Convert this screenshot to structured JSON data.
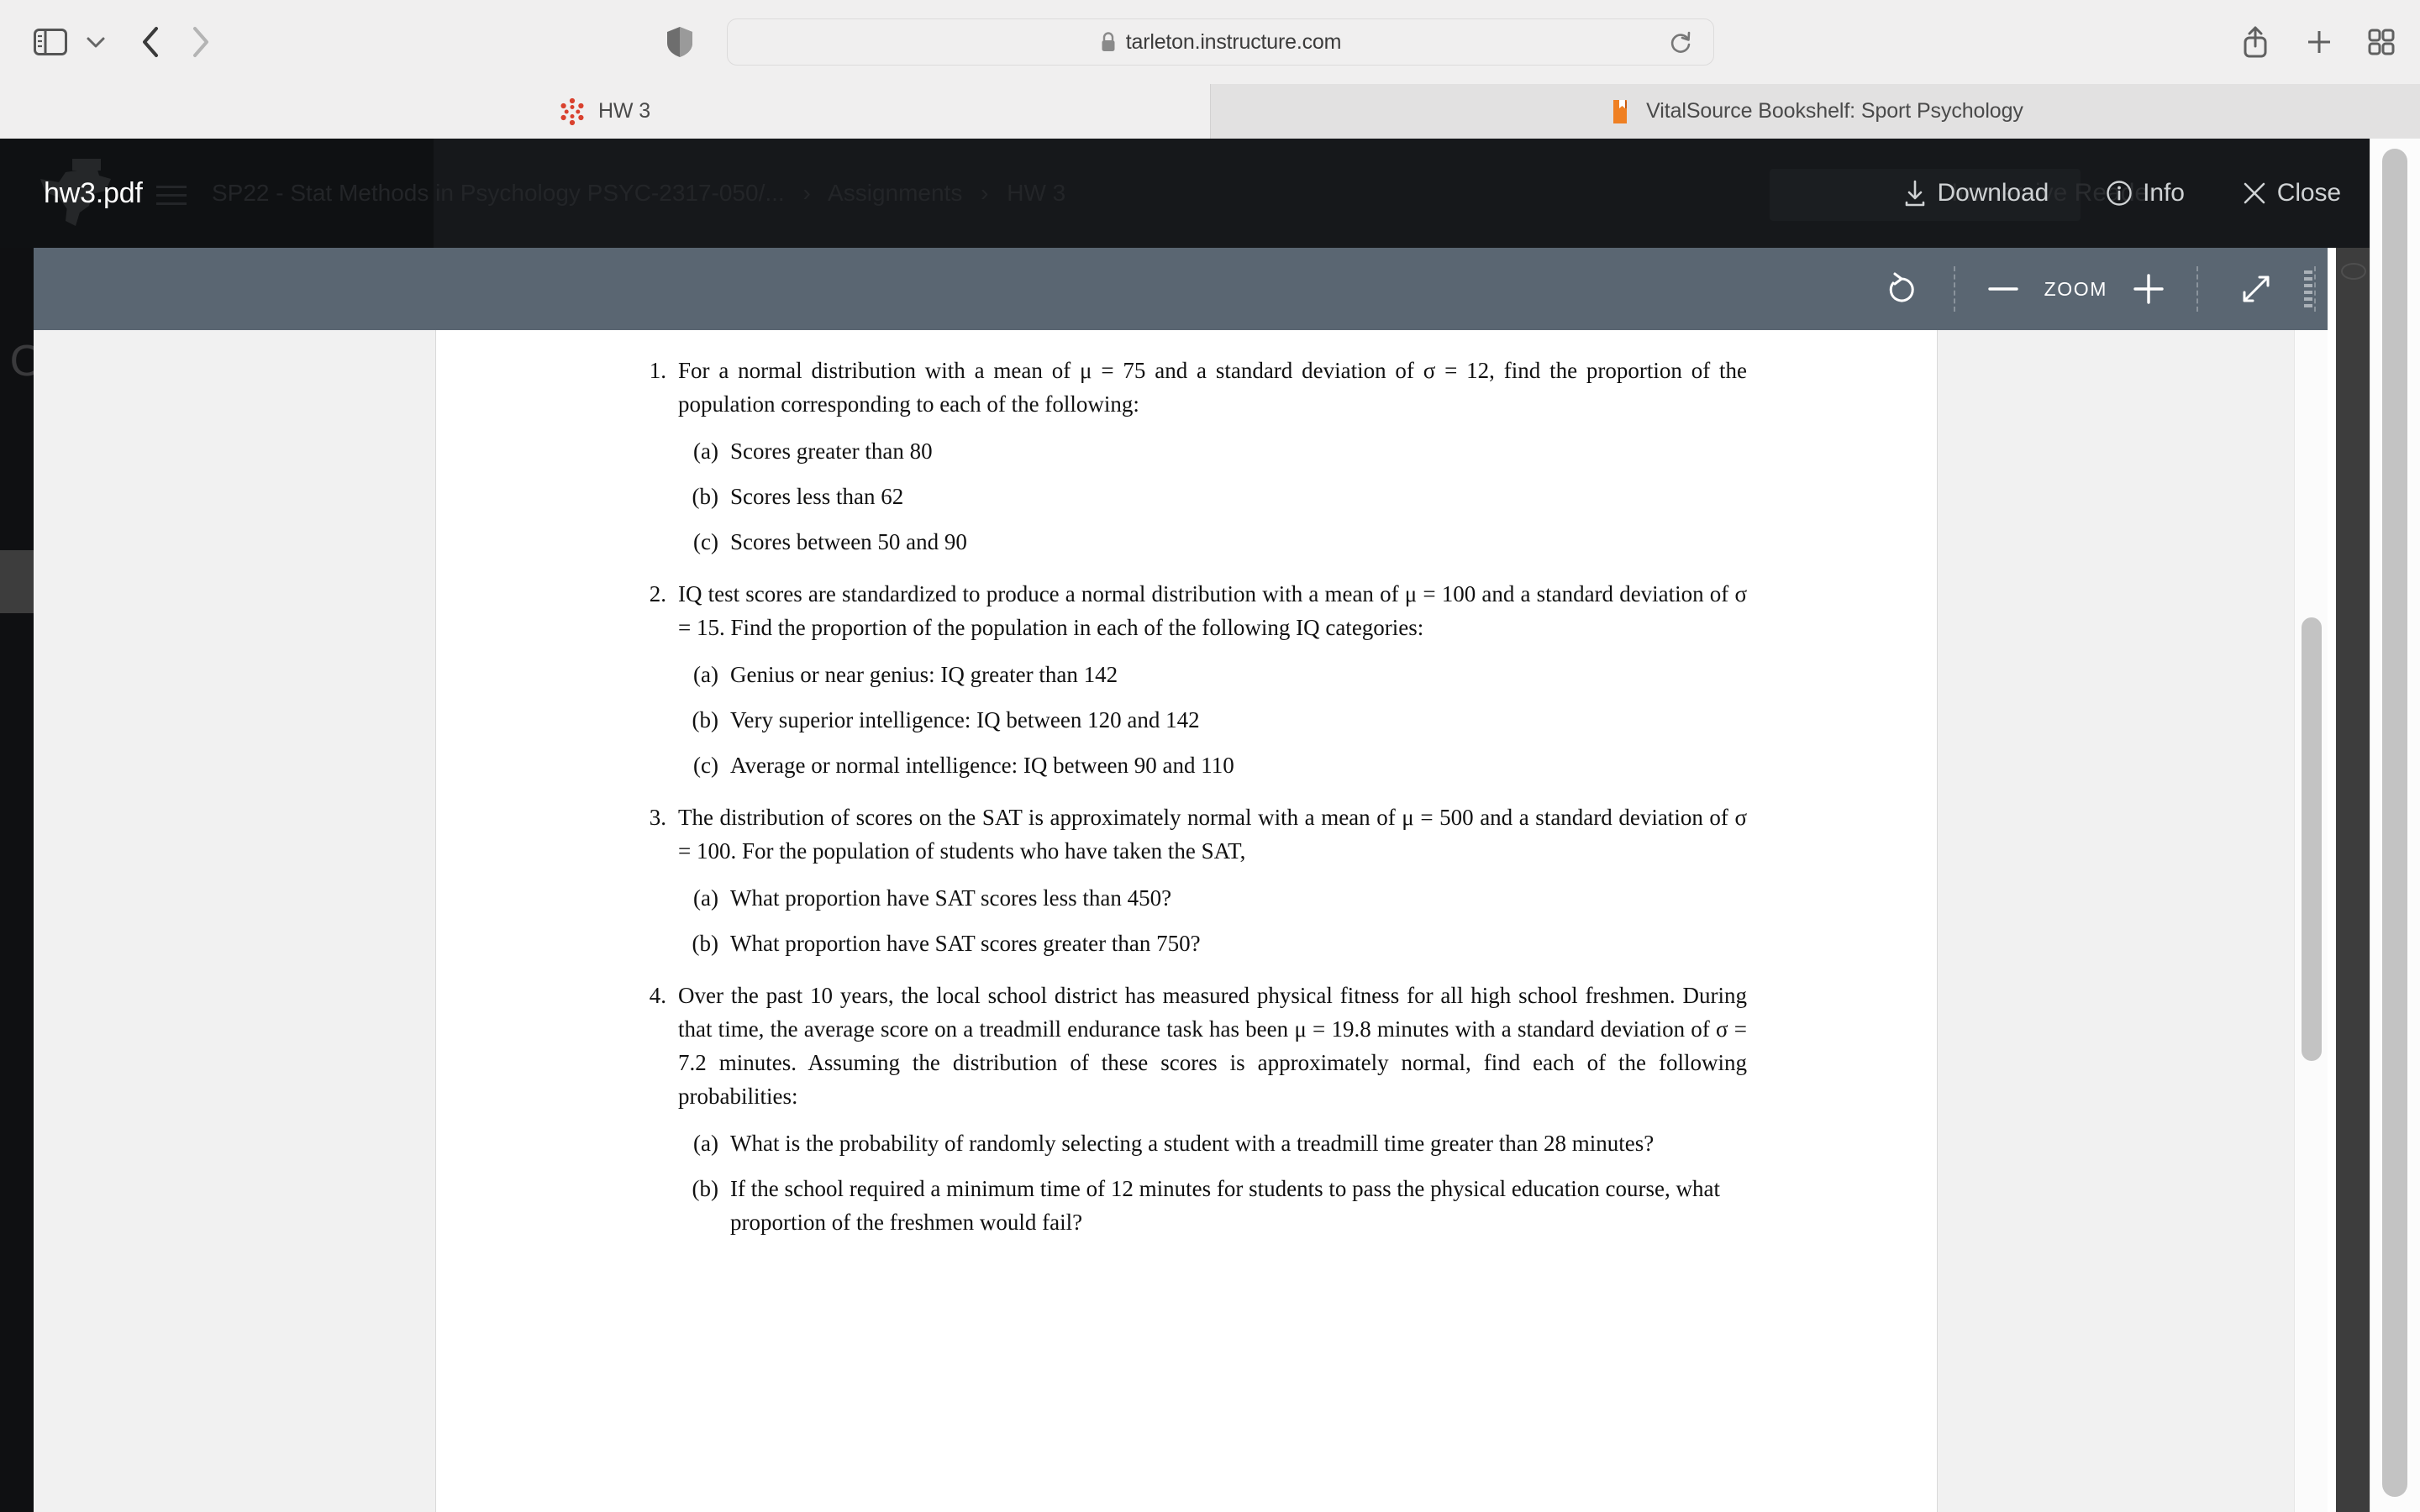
{
  "browser": {
    "address_bar": {
      "url": "tarleton.instructure.com",
      "lock_icon": "lock-icon",
      "reload_icon": "reload-icon"
    },
    "toolbar_icons": {
      "sidebar_toggle": "sidebar-toggle-icon",
      "sidebar_chevron": "chevron-down-icon",
      "back": "back-arrow-icon",
      "forward": "forward-arrow-icon",
      "privacy_shield": "shield-icon",
      "share": "share-icon",
      "new_tab": "plus-icon",
      "tab_overview": "grid-icon"
    },
    "tabs": [
      {
        "title": "HW 3",
        "favicon": "canvas-logo-icon",
        "active": true
      },
      {
        "title": "VitalSource Bookshelf: Sport Psychology",
        "favicon": "bookshelf-icon",
        "active": false
      }
    ]
  },
  "canvas": {
    "breadcrumb": {
      "menu_icon": "hamburger-icon",
      "course": "SP22 - Stat Methods in Psychology PSYC-2317-050/...",
      "section": "Assignments",
      "page": "HW 3",
      "separator": "›"
    },
    "course_nav_glyph": "O"
  },
  "pdf_viewer": {
    "filename": "hw3.pdf",
    "logo": "tarleton-texan-logo",
    "actions": [
      {
        "label": "Download",
        "icon": "download-icon"
      },
      {
        "label": "Info",
        "icon": "info-icon"
      },
      {
        "label": "Close",
        "icon": "close-icon"
      }
    ],
    "immersive_reader_ghost": "Immersive Reader",
    "toolbar": {
      "rotate_icon": "rotate-icon",
      "zoom_out_icon": "minus-icon",
      "zoom_label": "ZOOM",
      "zoom_in_icon": "plus-icon",
      "fullscreen_icon": "expand-arrows-icon",
      "grip_icon": "drag-grip-icon"
    }
  },
  "document": {
    "questions": [
      {
        "number": "1.",
        "text": "For a normal distribution with a mean of μ = 75 and a standard deviation of σ = 12, find the proportion of the population corresponding to each of the following:",
        "subs": [
          {
            "label": "(a)",
            "text": "Scores greater than 80"
          },
          {
            "label": "(b)",
            "text": "Scores less than 62"
          },
          {
            "label": "(c)",
            "text": "Scores between 50 and 90"
          }
        ]
      },
      {
        "number": "2.",
        "text": "IQ test scores are standardized to produce a normal distribution with a mean of μ = 100 and a standard deviation of σ = 15. Find the proportion of the population in each of the following IQ categories:",
        "subs": [
          {
            "label": "(a)",
            "text": "Genius or near genius: IQ greater than 142"
          },
          {
            "label": "(b)",
            "text": "Very superior intelligence: IQ between 120 and 142"
          },
          {
            "label": "(c)",
            "text": "Average or normal intelligence: IQ between 90 and 110"
          }
        ]
      },
      {
        "number": "3.",
        "text": "The distribution of scores on the SAT is approximately normal with a mean of μ = 500 and a standard deviation of σ = 100. For the population of students who have taken the SAT,",
        "subs": [
          {
            "label": "(a)",
            "text": "What proportion have SAT scores less than 450?"
          },
          {
            "label": "(b)",
            "text": "What proportion have SAT scores greater than 750?"
          }
        ]
      },
      {
        "number": "4.",
        "text": "Over the past 10 years, the local school district has measured physical fitness for all high school freshmen. During that time, the average score on a treadmill endurance task has been μ = 19.8 minutes with a standard deviation of σ = 7.2 minutes. Assuming the distribution of these scores is approximately normal, find each of the following probabilities:",
        "subs": [
          {
            "label": "(a)",
            "text": "What is the probability of randomly selecting a student with a treadmill time greater than 28 minutes?"
          },
          {
            "label": "(b)",
            "text": "If the school required a minimum time of 12 minutes for students to pass the physical education course, what proportion of the freshmen would fail?"
          }
        ]
      }
    ]
  }
}
